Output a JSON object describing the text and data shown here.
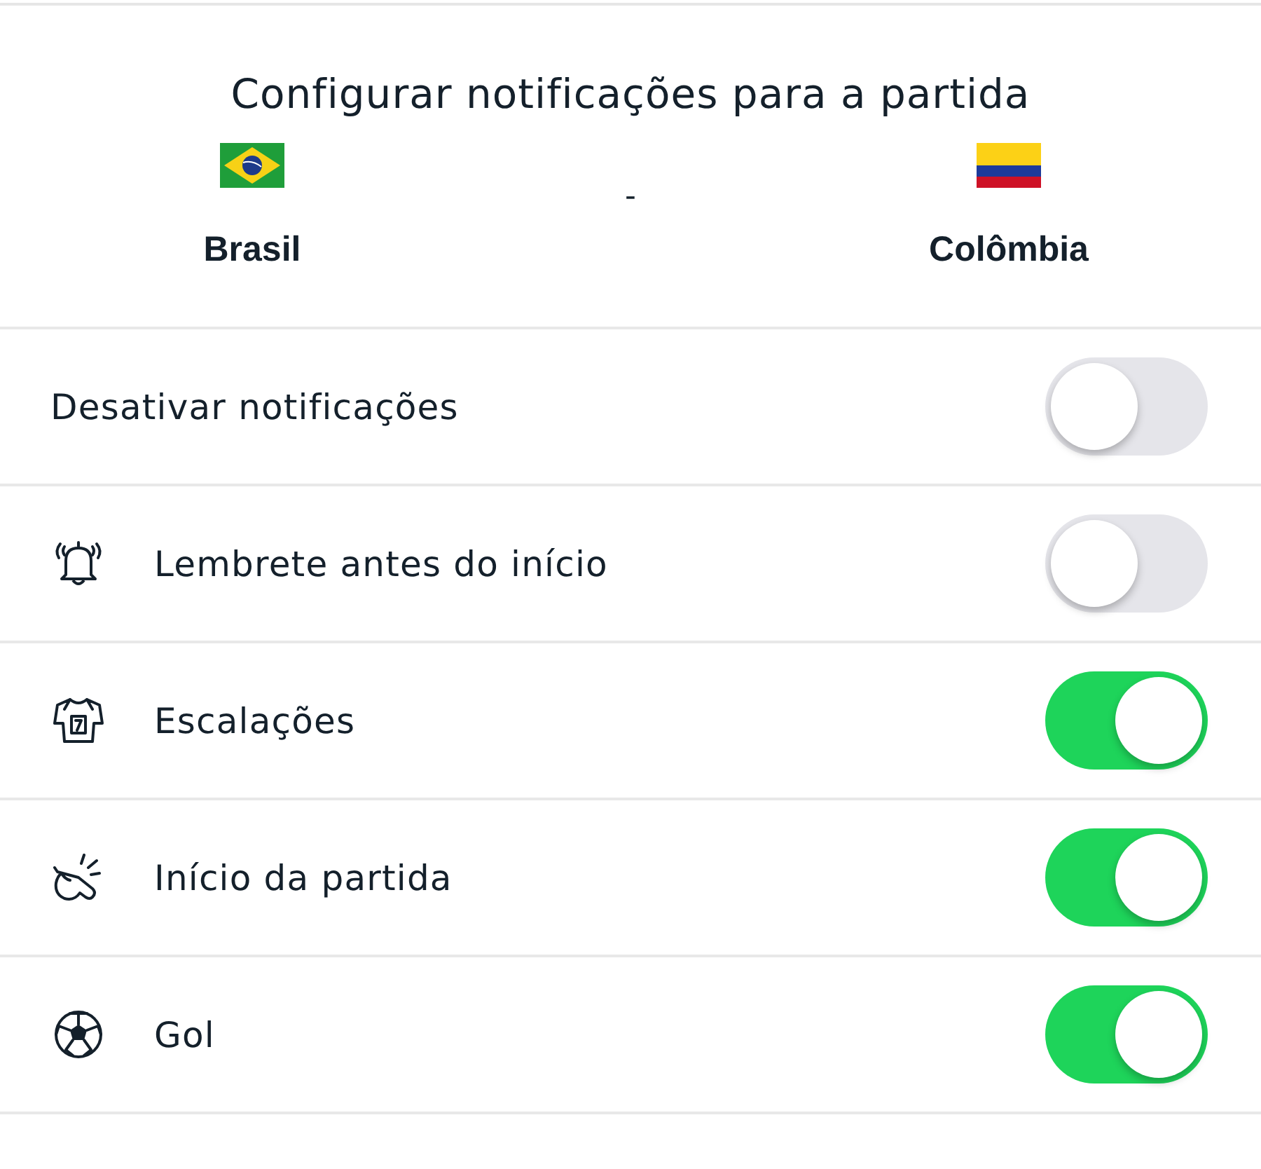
{
  "header": {
    "title": "Configurar notificações para a partida",
    "separator": "-",
    "teams": [
      {
        "name": "Brasil"
      },
      {
        "name": "Colômbia"
      }
    ]
  },
  "settings": [
    {
      "kind": "plain",
      "label": "Desativar notificações",
      "on": false
    },
    {
      "kind": "reminder",
      "label": "Lembrete antes do início",
      "on": false
    },
    {
      "kind": "lineups",
      "label": "Escalações",
      "on": true
    },
    {
      "kind": "kickoff",
      "label": "Início da partida",
      "on": true
    },
    {
      "kind": "goal",
      "label": "Gol",
      "on": true
    }
  ]
}
